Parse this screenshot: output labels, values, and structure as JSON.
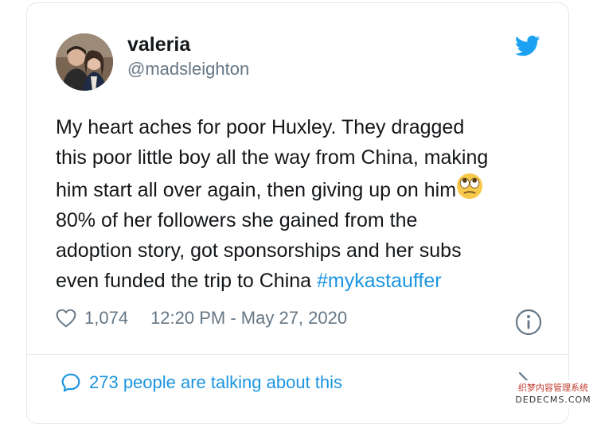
{
  "user": {
    "display_name": "valeria",
    "handle": "@madsleighton"
  },
  "tweet": {
    "lines": [
      "My heart aches for poor Huxley. They dragged",
      "this poor little boy all the way from China, making",
      "him start all over again, then giving up on him",
      "80% of her followers she gained from the",
      "adoption story, got sponsorships and her subs",
      "even funded the trip to China "
    ],
    "hashtag": "#mykastauffer",
    "emoji": "rolling-eyes-emoji"
  },
  "meta": {
    "likes": "1,074",
    "timestamp": "12:20 PM - May 27, 2020"
  },
  "footer": {
    "talking_text": "273 people are talking about this"
  },
  "watermark": {
    "line1": "织梦内容管理系统",
    "line2": "DEDECMS.COM"
  },
  "colors": {
    "twitter_blue": "#1da1f2",
    "link_blue": "#1b95e0",
    "secondary_text": "#657786",
    "border": "#e1e8ed"
  },
  "icons": [
    "twitter-bird-icon",
    "heart-icon",
    "info-icon",
    "speech-bubble-icon",
    "chevron-right-icon"
  ]
}
